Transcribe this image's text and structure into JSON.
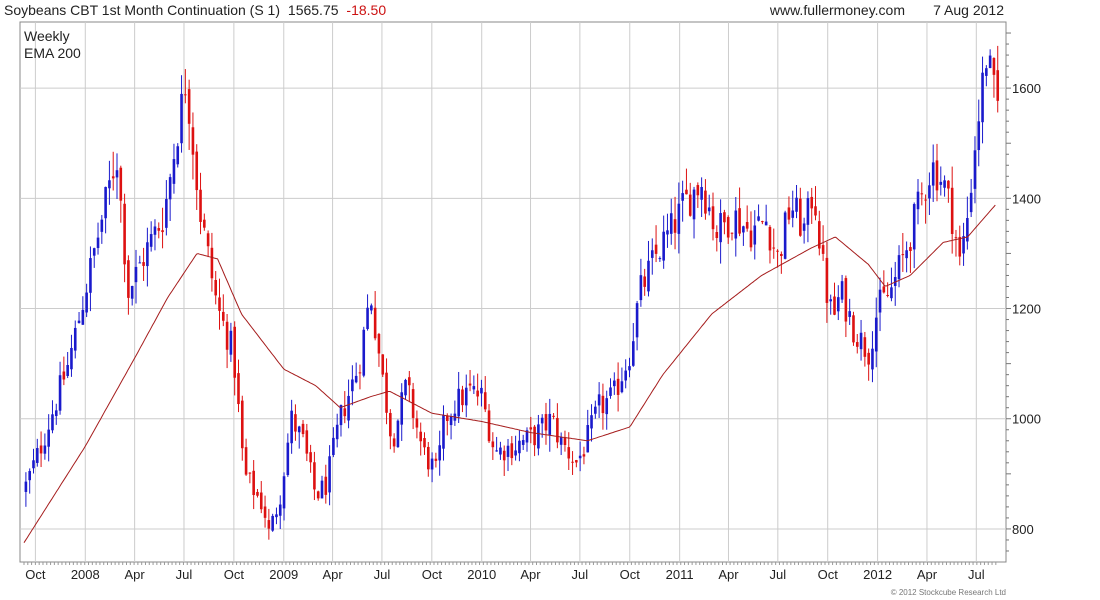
{
  "header": {
    "title": "Soybeans CBT 1st Month Continuation (S 1)",
    "last_price": "1565.75",
    "change": "-18.50",
    "website": "www.fullermoney.com",
    "date": "7 Aug 2012"
  },
  "footer": {
    "copyright": "© 2012 Stockcube Research Ltd"
  },
  "colors": {
    "up": "#1a1acc",
    "down": "#dd1111",
    "ema": "#a51c1c",
    "grid": "#cccccc",
    "change": "#cc1111"
  },
  "chart_data": {
    "type": "candlestick",
    "legend": [
      "Weekly",
      "EMA 200"
    ],
    "legend_placement": "top-left",
    "y_axis_position": "right",
    "ylim": [
      740,
      1720
    ],
    "yticks": [
      800,
      1000,
      1200,
      1400,
      1600
    ],
    "x_range": [
      "2007-09-10",
      "2012-08-10"
    ],
    "xticks": [
      {
        "date": "2007-10-01",
        "label": "Oct"
      },
      {
        "date": "2008-01-01",
        "label": "2008"
      },
      {
        "date": "2008-04-01",
        "label": "Apr"
      },
      {
        "date": "2008-07-01",
        "label": "Jul"
      },
      {
        "date": "2008-10-01",
        "label": "Oct"
      },
      {
        "date": "2009-01-01",
        "label": "2009"
      },
      {
        "date": "2009-04-01",
        "label": "Apr"
      },
      {
        "date": "2009-07-01",
        "label": "Jul"
      },
      {
        "date": "2009-10-01",
        "label": "Oct"
      },
      {
        "date": "2010-01-01",
        "label": "2010"
      },
      {
        "date": "2010-04-01",
        "label": "Apr"
      },
      {
        "date": "2010-07-01",
        "label": "Jul"
      },
      {
        "date": "2010-10-01",
        "label": "Oct"
      },
      {
        "date": "2011-01-01",
        "label": "2011"
      },
      {
        "date": "2011-04-01",
        "label": "Apr"
      },
      {
        "date": "2011-07-01",
        "label": "Jul"
      },
      {
        "date": "2011-10-01",
        "label": "Oct"
      },
      {
        "date": "2012-01-01",
        "label": "2012"
      },
      {
        "date": "2012-04-01",
        "label": "Apr"
      },
      {
        "date": "2012-07-01",
        "label": "Jul"
      }
    ],
    "grid": true,
    "weekly_close_anchors": [
      [
        "2007-09-10",
        870
      ],
      [
        "2007-10-15",
        960
      ],
      [
        "2007-12-01",
        1100
      ],
      [
        "2008-01-10",
        1270
      ],
      [
        "2008-02-28",
        1480
      ],
      [
        "2008-03-20",
        1230
      ],
      [
        "2008-04-25",
        1310
      ],
      [
        "2008-05-25",
        1370
      ],
      [
        "2008-07-05",
        1620
      ],
      [
        "2008-07-30",
        1380
      ],
      [
        "2008-09-01",
        1200
      ],
      [
        "2008-09-30",
        1120
      ],
      [
        "2008-10-20",
        900
      ],
      [
        "2008-11-25",
        840
      ],
      [
        "2008-12-05",
        790
      ],
      [
        "2008-12-25",
        860
      ],
      [
        "2009-01-15",
        1000
      ],
      [
        "2009-02-05",
        960
      ],
      [
        "2009-03-01",
        860
      ],
      [
        "2009-03-20",
        880
      ],
      [
        "2009-04-15",
        1000
      ],
      [
        "2009-05-20",
        1100
      ],
      [
        "2009-06-10",
        1230
      ],
      [
        "2009-07-01",
        1080
      ],
      [
        "2009-07-20",
        960
      ],
      [
        "2009-08-15",
        1060
      ],
      [
        "2009-09-15",
        940
      ],
      [
        "2009-10-10",
        900
      ],
      [
        "2009-10-25",
        1000
      ],
      [
        "2009-11-15",
        1030
      ],
      [
        "2009-12-10",
        1050
      ],
      [
        "2010-01-01",
        1040
      ],
      [
        "2010-01-25",
        940
      ],
      [
        "2010-03-01",
        950
      ],
      [
        "2010-04-10",
        970
      ],
      [
        "2010-05-10",
        1000
      ],
      [
        "2010-05-25",
        960
      ],
      [
        "2010-06-25",
        920
      ],
      [
        "2010-07-10",
        950
      ],
      [
        "2010-08-05",
        1020
      ],
      [
        "2010-09-01",
        1040
      ],
      [
        "2010-10-01",
        1120
      ],
      [
        "2010-10-20",
        1230
      ],
      [
        "2010-11-20",
        1300
      ],
      [
        "2010-12-15",
        1340
      ],
      [
        "2011-01-10",
        1390
      ],
      [
        "2011-02-10",
        1430
      ],
      [
        "2011-03-10",
        1340
      ],
      [
        "2011-04-10",
        1370
      ],
      [
        "2011-05-10",
        1340
      ],
      [
        "2011-06-10",
        1360
      ],
      [
        "2011-07-01",
        1290
      ],
      [
        "2011-07-25",
        1390
      ],
      [
        "2011-08-20",
        1340
      ],
      [
        "2011-09-05",
        1420
      ],
      [
        "2011-09-25",
        1250
      ],
      [
        "2011-10-10",
        1180
      ],
      [
        "2011-10-25",
        1230
      ],
      [
        "2011-11-20",
        1160
      ],
      [
        "2011-12-15",
        1120
      ],
      [
        "2012-01-01",
        1200
      ],
      [
        "2012-01-25",
        1230
      ],
      [
        "2012-02-20",
        1300
      ],
      [
        "2012-03-15",
        1380
      ],
      [
        "2012-04-10",
        1460
      ],
      [
        "2012-05-01",
        1430
      ],
      [
        "2012-05-20",
        1360
      ],
      [
        "2012-06-01",
        1280
      ],
      [
        "2012-06-15",
        1370
      ],
      [
        "2012-07-01",
        1520
      ],
      [
        "2012-07-20",
        1660
      ],
      [
        "2012-08-07",
        1566
      ]
    ],
    "ema_200_anchors": [
      [
        "2007-09-10",
        775
      ],
      [
        "2008-01-01",
        950
      ],
      [
        "2008-04-01",
        1110
      ],
      [
        "2008-06-01",
        1220
      ],
      [
        "2008-07-25",
        1300
      ],
      [
        "2008-09-01",
        1290
      ],
      [
        "2008-10-15",
        1190
      ],
      [
        "2009-01-01",
        1090
      ],
      [
        "2009-03-01",
        1060
      ],
      [
        "2009-04-15",
        1020
      ],
      [
        "2009-06-10",
        1040
      ],
      [
        "2009-07-15",
        1050
      ],
      [
        "2009-10-01",
        1010
      ],
      [
        "2010-01-01",
        995
      ],
      [
        "2010-04-01",
        975
      ],
      [
        "2010-07-15",
        960
      ],
      [
        "2010-10-01",
        985
      ],
      [
        "2010-12-01",
        1080
      ],
      [
        "2011-03-01",
        1190
      ],
      [
        "2011-06-01",
        1260
      ],
      [
        "2011-09-01",
        1310
      ],
      [
        "2011-10-15",
        1330
      ],
      [
        "2011-12-15",
        1280
      ],
      [
        "2012-01-15",
        1240
      ],
      [
        "2012-03-01",
        1260
      ],
      [
        "2012-05-01",
        1320
      ],
      [
        "2012-06-15",
        1330
      ],
      [
        "2012-08-07",
        1390
      ]
    ]
  }
}
